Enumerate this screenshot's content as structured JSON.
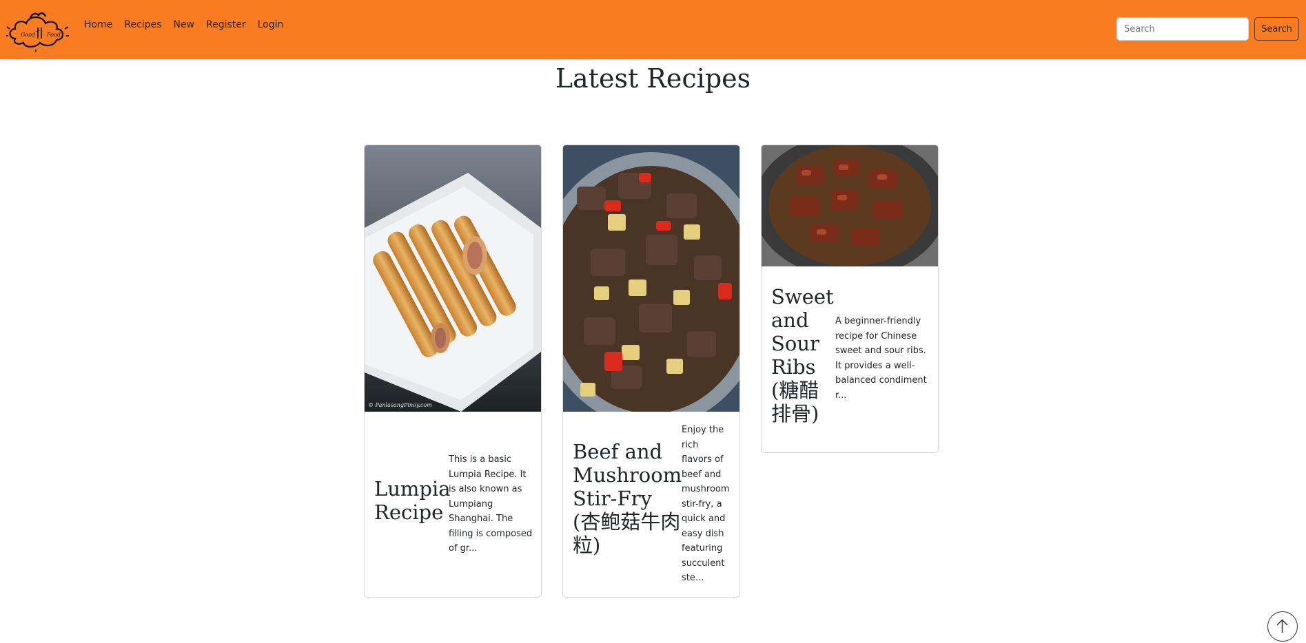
{
  "navbar": {
    "logo_alt": "Good Food",
    "logo_text_left": "Good",
    "logo_text_right": "Food",
    "links": [
      "Home",
      "Recipes",
      "New",
      "Register",
      "Login"
    ],
    "search_placeholder": "Search",
    "search_button": "Search"
  },
  "main": {
    "title": "Latest Recipes",
    "cards": [
      {
        "title": "Lumpia Recipe",
        "description": "This is a basic Lumpia Recipe. It is also known as Lumpiang Shanghai. The filling is composed of gr...",
        "image_caption": "© PanlasangPinoy.com"
      },
      {
        "title": "Beef and Mushroom Stir-Fry (杏鲍菇牛肉粒)",
        "description": "Enjoy the rich flavors of beef and mushroom stir-fry, a quick and easy dish featuring succulent ste..."
      },
      {
        "title": "Sweet and Sour Ribs (糖醋排骨)",
        "description": "A beginner-friendly recipe for Chinese sweet and sour ribs. It provides a well-balanced condiment r..."
      }
    ]
  },
  "colors": {
    "navbar": "#f97c22",
    "text": "#212529"
  },
  "icons": {
    "scroll_top": "arrow-up-icon"
  }
}
